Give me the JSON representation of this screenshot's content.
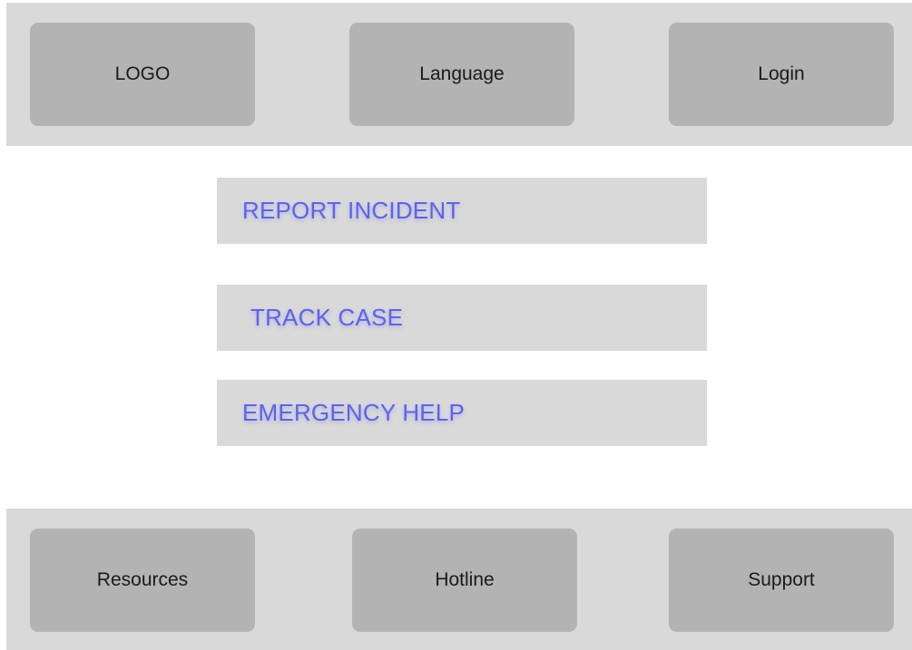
{
  "header": {
    "logo_label": "LOGO",
    "language_label": "Language",
    "login_label": "Login"
  },
  "actions": {
    "report_incident": "REPORT INCIDENT",
    "track_case": "TRACK CASE",
    "emergency_help": "EMERGENCY HELP"
  },
  "footer": {
    "resources_label": "Resources",
    "hotline_label": "Hotline",
    "support_label": "Support"
  },
  "colors": {
    "bar_background": "#d9d9d9",
    "tile_background": "#b3b3b3",
    "action_text": "#5b63ee"
  }
}
